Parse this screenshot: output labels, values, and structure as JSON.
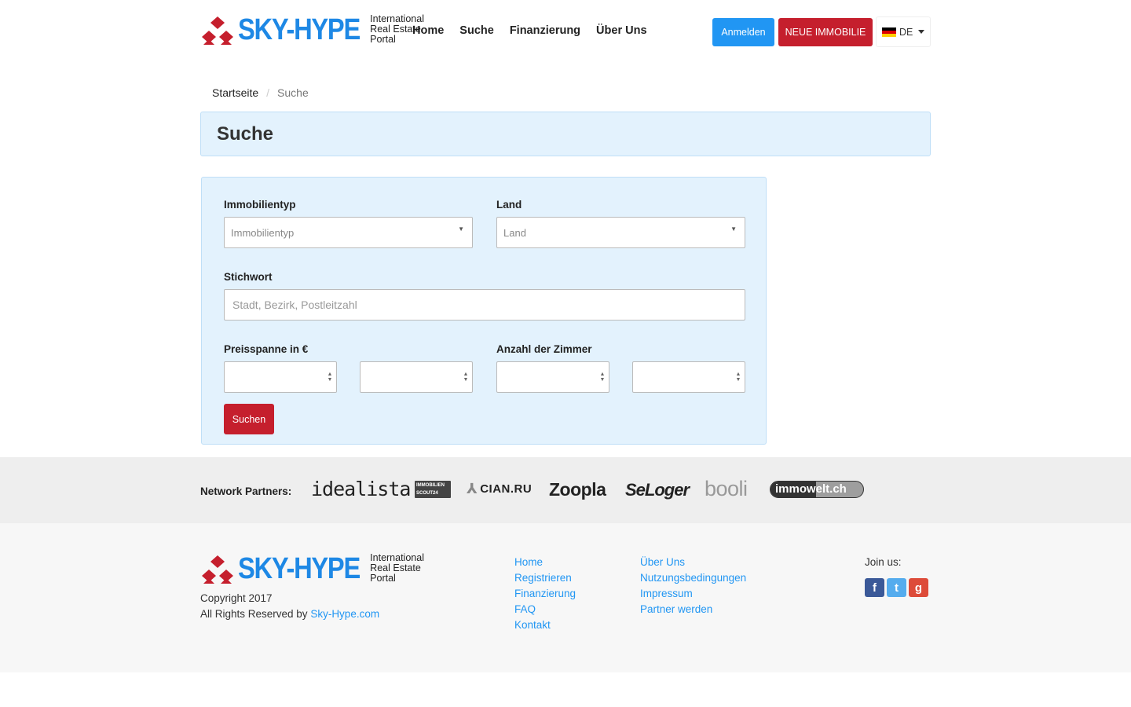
{
  "brand": {
    "name": "SKY-HYPE",
    "tagline": "International\nReal Estate\nPortal",
    "primary_color": "#1e88e5",
    "accent_color": "#c51f2d"
  },
  "nav": {
    "items": [
      {
        "label": "Home"
      },
      {
        "label": "Suche"
      },
      {
        "label": "Finanzierung"
      },
      {
        "label": "Über Uns"
      }
    ],
    "login_label": "Anmelden",
    "new_property_label": "NEUE IMMOBILIE",
    "language": "DE"
  },
  "breadcrumb": {
    "home": "Startseite",
    "separator": "/",
    "current": "Suche"
  },
  "page_title": "Suche",
  "form": {
    "property_type": {
      "label": "Immobilientyp",
      "placeholder": "Immobilientyp"
    },
    "country": {
      "label": "Land",
      "placeholder": "Land"
    },
    "keyword": {
      "label": "Stichwort",
      "placeholder": "Stadt, Bezirk, Postleitzahl"
    },
    "price_range": {
      "label": "Preisspanne in €"
    },
    "rooms": {
      "label": "Anzahl der Zimmer"
    },
    "submit_label": "Suchen"
  },
  "partners": {
    "label": "Network Partners:",
    "logos": [
      "idealista",
      "IMMOBILIEN SCOUT24",
      "CIAN.RU",
      "Zoopla",
      "SeLoger",
      "booli",
      "immowelt.ch"
    ]
  },
  "footer": {
    "copyright": "Copyright 2017",
    "rights_prefix": "All Rights Reserved by ",
    "rights_link": "Sky-Hype.com",
    "col1": [
      "Home",
      "Registrieren",
      "Finanzierung",
      "FAQ",
      "Kontakt"
    ],
    "col2": [
      "Über Uns",
      "Nutzungsbedingungen",
      "Impressum",
      "Partner werden"
    ],
    "join_label": "Join us:",
    "social": [
      {
        "icon": "facebook-icon",
        "glyph": "f",
        "color": "#3b5998"
      },
      {
        "icon": "twitter-icon",
        "glyph": "t",
        "color": "#55acee"
      },
      {
        "icon": "google-plus-icon",
        "glyph": "g",
        "color": "#dd4b39"
      }
    ]
  }
}
